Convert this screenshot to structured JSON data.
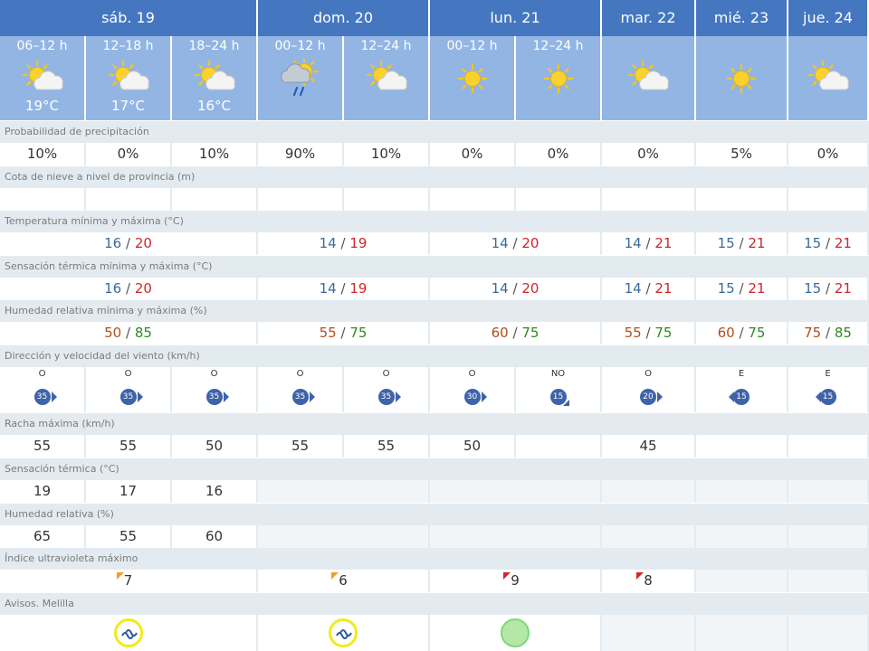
{
  "colors": {
    "header_day_bg": "#4577c0",
    "header_period_bg": "#93b5e3",
    "section_bg": "#e3ebf0",
    "temp_min": "#3a6b9a",
    "temp_max": "#d0252b",
    "humidity_min": "#b04f1a",
    "humidity_max": "#2e8a1f",
    "wind_badge": "#3f63a8",
    "uv_orange": "#f0a020",
    "uv_red": "#d0252b",
    "aviso_yellow": "#f2ea1c",
    "aviso_green": "#b5e8a6"
  },
  "days": [
    {
      "label": "sáb. 19"
    },
    {
      "label": "dom. 20"
    },
    {
      "label": "lun. 21"
    },
    {
      "label": "mar. 22"
    },
    {
      "label": "mié. 23"
    },
    {
      "label": "jue. 24"
    }
  ],
  "periods": [
    {
      "label": "06–12 h",
      "icon": "sun-behind-cloud-icon",
      "temp": "19°C"
    },
    {
      "label": "12–18 h",
      "icon": "sun-behind-cloud-icon",
      "temp": "17°C"
    },
    {
      "label": "18–24 h",
      "icon": "sun-behind-cloud-icon",
      "temp": "16°C"
    },
    {
      "label": "00–12 h",
      "icon": "cloud-rain-sun-icon",
      "temp": ""
    },
    {
      "label": "12–24 h",
      "icon": "sun-behind-cloud-icon",
      "temp": ""
    },
    {
      "label": "00–12 h",
      "icon": "sun-icon",
      "temp": ""
    },
    {
      "label": "12–24 h",
      "icon": "sun-icon",
      "temp": ""
    },
    {
      "label": "",
      "icon": "sun-behind-cloud-icon",
      "temp": ""
    },
    {
      "label": "",
      "icon": "sun-icon",
      "temp": ""
    },
    {
      "label": "",
      "icon": "sun-behind-cloud-icon",
      "temp": ""
    }
  ],
  "sections": {
    "precip": "Probabilidad de precipitación",
    "snow": "Cota de nieve a nivel de provincia (m)",
    "temp_minmax": "Temperatura mínima y máxima (°C)",
    "feels_minmax": "Sensación térmica mínima y máxima (°C)",
    "humidity_minmax": "Humedad relativa mínima y máxima (%)",
    "wind": "Dirección y velocidad del viento (km/h)",
    "gust": "Racha máxima (km/h)",
    "feels": "Sensación térmica (°C)",
    "humidity": "Humedad relativa (%)",
    "uv": "Índice ultravioleta máximo",
    "warnings": "Avisos. Melilla"
  },
  "precip": [
    "10%",
    "0%",
    "10%",
    "90%",
    "10%",
    "0%",
    "0%",
    "0%",
    "5%",
    "0%"
  ],
  "separator": "/",
  "temp_minmax": [
    {
      "min": "16",
      "max": "20"
    },
    {
      "min": "14",
      "max": "19"
    },
    {
      "min": "14",
      "max": "20"
    },
    {
      "min": "14",
      "max": "21"
    },
    {
      "min": "15",
      "max": "21"
    },
    {
      "min": "15",
      "max": "21"
    }
  ],
  "feels_minmax": [
    {
      "min": "16",
      "max": "20"
    },
    {
      "min": "14",
      "max": "19"
    },
    {
      "min": "14",
      "max": "20"
    },
    {
      "min": "14",
      "max": "21"
    },
    {
      "min": "15",
      "max": "21"
    },
    {
      "min": "15",
      "max": "21"
    }
  ],
  "humidity_minmax": [
    {
      "min": "50",
      "max": "85"
    },
    {
      "min": "55",
      "max": "75"
    },
    {
      "min": "60",
      "max": "75"
    },
    {
      "min": "55",
      "max": "75"
    },
    {
      "min": "60",
      "max": "75"
    },
    {
      "min": "75",
      "max": "85"
    }
  ],
  "wind": [
    {
      "dir": "O",
      "speed": "35",
      "arrow": "arrow-right-icon"
    },
    {
      "dir": "O",
      "speed": "35",
      "arrow": "arrow-right-icon"
    },
    {
      "dir": "O",
      "speed": "35",
      "arrow": "arrow-right-icon"
    },
    {
      "dir": "O",
      "speed": "35",
      "arrow": "arrow-right-icon"
    },
    {
      "dir": "O",
      "speed": "35",
      "arrow": "arrow-right-icon"
    },
    {
      "dir": "O",
      "speed": "30",
      "arrow": "arrow-right-icon"
    },
    {
      "dir": "NO",
      "speed": "15",
      "arrow": "arrow-down-right-icon"
    },
    {
      "dir": "O",
      "speed": "20",
      "arrow": "arrow-right-icon"
    },
    {
      "dir": "E",
      "speed": "15",
      "arrow": "arrow-left-icon"
    },
    {
      "dir": "E",
      "speed": "15",
      "arrow": "arrow-left-icon"
    }
  ],
  "gust": [
    "55",
    "55",
    "50",
    "55",
    "55",
    "50",
    "",
    "45",
    "",
    ""
  ],
  "feels": [
    "19",
    "17",
    "16"
  ],
  "humidity": [
    "65",
    "55",
    "60"
  ],
  "uv": [
    {
      "value": "7",
      "flag": "orange"
    },
    {
      "value": "6",
      "flag": "orange"
    },
    {
      "value": "9",
      "flag": "red"
    },
    {
      "value": "8",
      "flag": "red"
    }
  ],
  "warnings": [
    {
      "level": "yellow",
      "icon": "coastal-waves-icon"
    },
    {
      "level": "yellow",
      "icon": "coastal-waves-icon"
    },
    {
      "level": "green",
      "icon": "no-warning-icon"
    }
  ]
}
